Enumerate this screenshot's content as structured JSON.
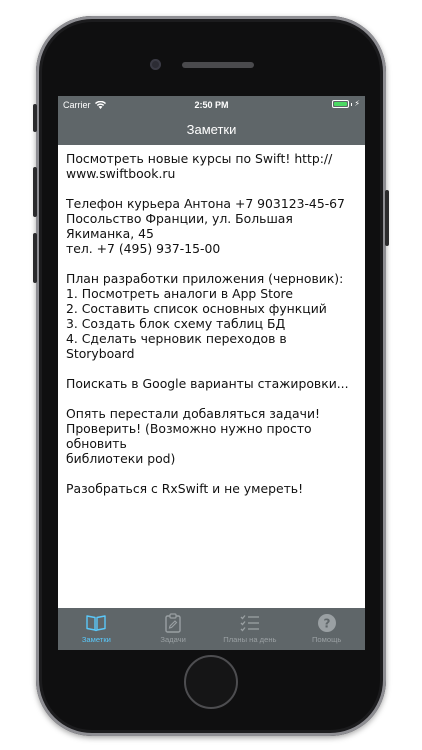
{
  "status_bar": {
    "carrier": "Carrier",
    "time": "2:50 PM",
    "battery_color": "#4cd964"
  },
  "nav": {
    "title": "Заметки"
  },
  "note": {
    "text": "Посмотреть новые курсы по Swift! http://\nwww.swiftbook.ru\n\nТелефон курьера Антона +7 903123-45-67\nПосольство Франции, ул. Большая Якиманка, 45\nтел. +7 (495) 937-15-00\n\nПлан разработки приложения (черновик):\n1. Посмотреть аналоги в App Store\n2. Составить список основных функций\n3. Создать блок схему таблиц БД\n4. Сделать черновик переходов в Storyboard\n\nПоискать в Google варианты стажировки...\n\nОпять перестали добавляться задачи!\nПроверить! (Возможно нужно просто обновить\nбиблиотеки pod)\n\nРазобраться с RxSwift и не умереть!"
  },
  "tabs": [
    {
      "label": "Заметки",
      "icon": "book-icon",
      "active": true
    },
    {
      "label": "Задачи",
      "icon": "clipboard-icon",
      "active": false
    },
    {
      "label": "Планы на день",
      "icon": "checklist-icon",
      "active": false
    },
    {
      "label": "Помощь",
      "icon": "help-icon",
      "active": false
    }
  ],
  "colors": {
    "bar_background": "#5f6669",
    "tab_active": "#5ac8fa",
    "tab_inactive": "#9aa0a3"
  }
}
